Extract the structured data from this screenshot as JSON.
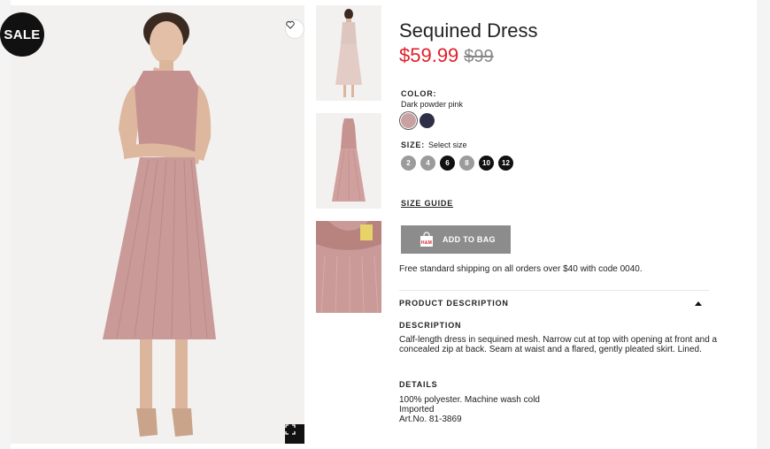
{
  "badge": {
    "sale": "SALE"
  },
  "product": {
    "title": "Sequined Dress",
    "price_now": "$59.99",
    "price_was": "$99",
    "color_label": "COLOR:",
    "color_name": "Dark powder pink",
    "colors": [
      "#c9a1a1",
      "#2c2f45"
    ],
    "size_label": "SIZE:",
    "size_select": "Select size",
    "sizes": [
      {
        "label": "2",
        "available": false
      },
      {
        "label": "4",
        "available": false
      },
      {
        "label": "6",
        "available": true
      },
      {
        "label": "8",
        "available": false
      },
      {
        "label": "10",
        "available": true
      },
      {
        "label": "12",
        "available": true
      }
    ],
    "size_guide": "SIZE GUIDE",
    "add_to_bag": "ADD TO BAG",
    "bag_logo": "H&M",
    "shipping": "Free standard shipping on all orders over $40 with code 0040."
  },
  "description": {
    "section_title": "PRODUCT DESCRIPTION",
    "desc_label": "DESCRIPTION",
    "desc_text": "Calf-length dress in sequined mesh. Narrow cut at top with opening at front and a concealed zip at back. Seam at waist and a flared, gently pleated skirt. Lined.",
    "details_label": "DETAILS",
    "details": [
      "100% polyester. Machine wash cold",
      "Imported",
      "Art.No. 81-3869"
    ]
  },
  "icons": {
    "favorite": "heart-icon",
    "fullscreen": "expand-icon",
    "bag": "shopping-bag-icon",
    "collapse": "chevron-up-icon"
  },
  "colors": {
    "sale_price": "#e0202b",
    "dress": "#c99a97",
    "button": "#8c8c8c"
  }
}
